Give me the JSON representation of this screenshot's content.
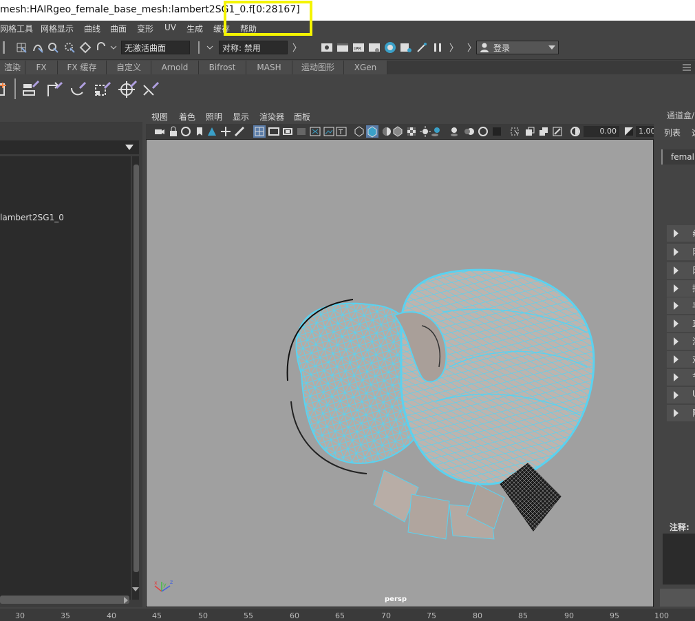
{
  "window": {
    "title": "mesh:HAIRgeo_female_base_mesh:lambert2SG1_0.f[0:28167]"
  },
  "menubar": {
    "items": [
      "网格工具",
      "网格显示",
      "曲线",
      "曲面",
      "变形",
      "UV",
      "生成",
      "缓存",
      "帮助"
    ]
  },
  "statusline": {
    "no_live_surface": "无激活曲面",
    "symmetry": "对称: 禁用",
    "login": "登录"
  },
  "shelf": {
    "tabs": [
      "渲染",
      "FX",
      "FX 缓存",
      "自定义",
      "Arnold",
      "Bifrost",
      "MASH",
      "运动图形",
      "XGen"
    ]
  },
  "outliner": {
    "items": [
      "lambert2SG1_0"
    ]
  },
  "viewport": {
    "menus": [
      "视图",
      "着色",
      "照明",
      "显示",
      "渲染器",
      "面板"
    ],
    "exposure_value": "0.00",
    "gamma_value": "1.00",
    "camera_label": "persp",
    "axis": {
      "x": "x",
      "y": "y",
      "z": "z"
    }
  },
  "channelbox": {
    "tab_label": "通道盒/",
    "list_label": "列表",
    "node_name": "femal",
    "sections": [
      "纟",
      "阝",
      "阝",
      "拐",
      "丰",
      "直",
      "涂",
      "对",
      "节",
      "U",
      "附"
    ],
    "notes_label": "注释:"
  },
  "timeline": {
    "ticks": [
      "30",
      "35",
      "40",
      "45",
      "50",
      "55",
      "60",
      "65",
      "70",
      "75",
      "80",
      "85",
      "90",
      "95",
      "100"
    ]
  },
  "colors": {
    "wireframe": "#5ad2f0",
    "viewport_bg": "#a0a0a0",
    "highlight": "#f4f400"
  }
}
